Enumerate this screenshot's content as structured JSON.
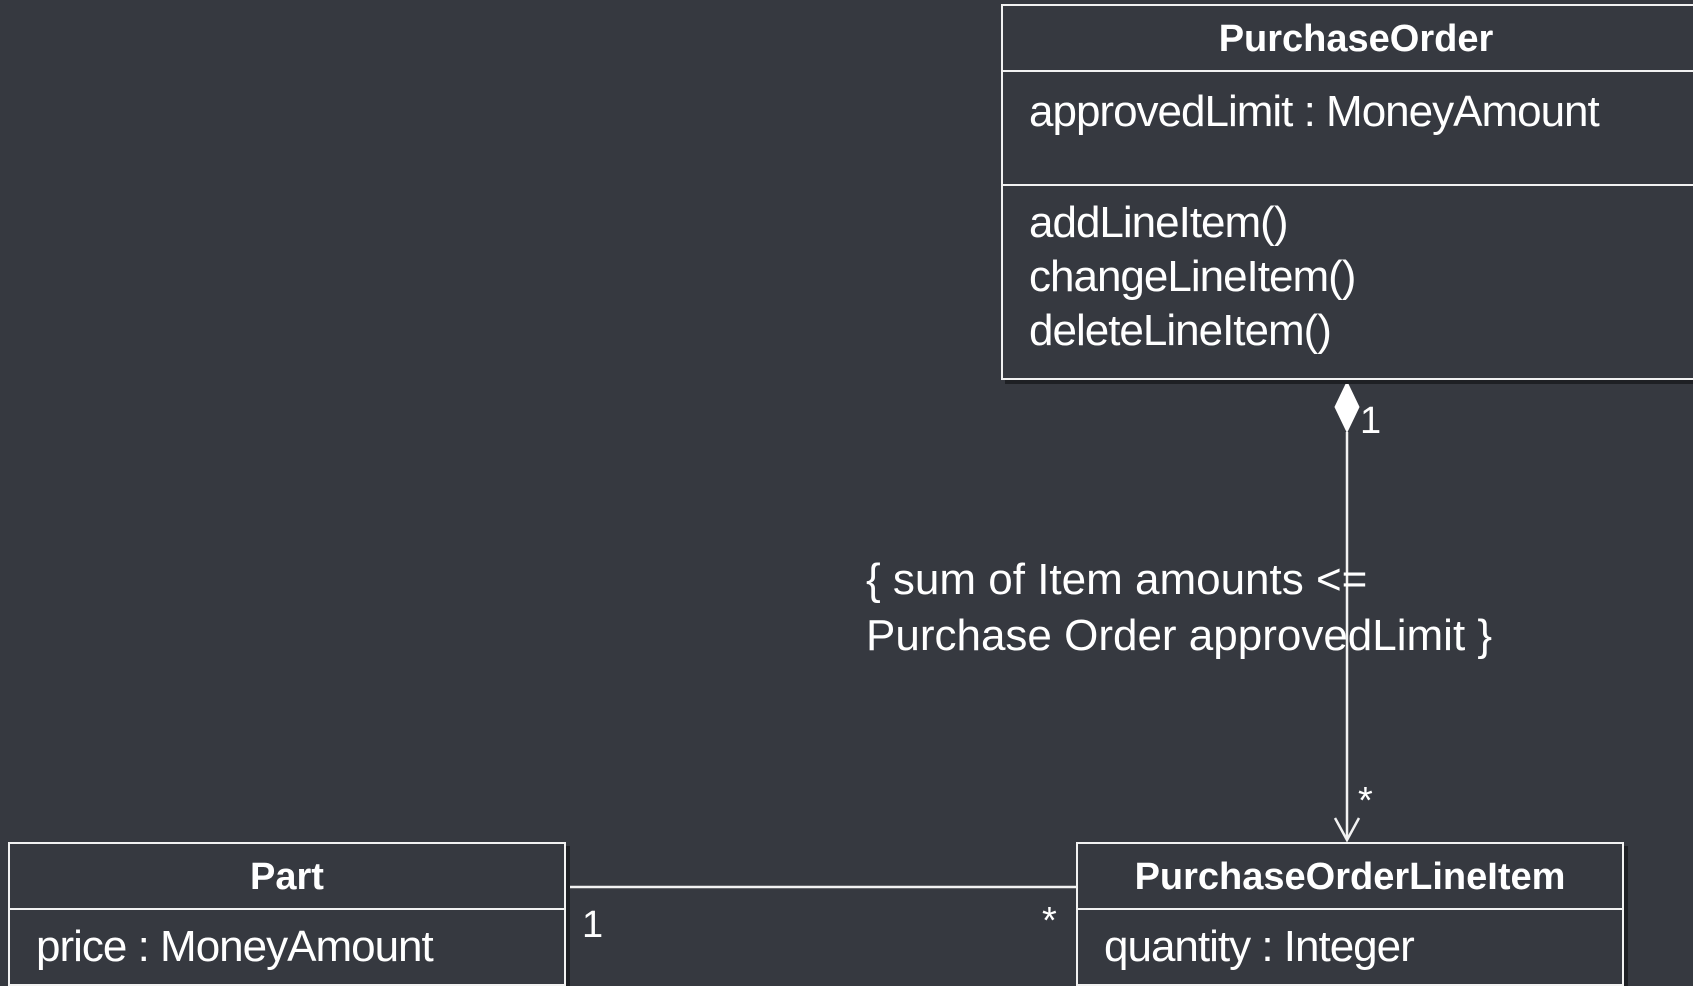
{
  "classes": {
    "purchase_order": {
      "name": "PurchaseOrder",
      "attributes": [
        "approvedLimit : MoneyAmount"
      ],
      "operations": [
        "addLineItem()",
        "changeLineItem()",
        "deleteLineItem()"
      ]
    },
    "part": {
      "name": "Part",
      "attributes": [
        "price : MoneyAmount"
      ]
    },
    "line_item": {
      "name": "PurchaseOrderLineItem",
      "attributes": [
        "quantity : Integer"
      ]
    }
  },
  "associations": {
    "composition": {
      "type": "composition",
      "source_multiplicity": "1",
      "target_multiplicity": "*"
    },
    "part_line_item": {
      "type": "association",
      "part_multiplicity": "1",
      "line_item_multiplicity": "*"
    }
  },
  "constraint": {
    "line1": "{ sum of Item amounts <=",
    "line2": "Purchase Order approvedLimit }"
  },
  "colors": {
    "background": "#363940",
    "foreground": "#ffffff",
    "line": "#f2f2f2"
  }
}
